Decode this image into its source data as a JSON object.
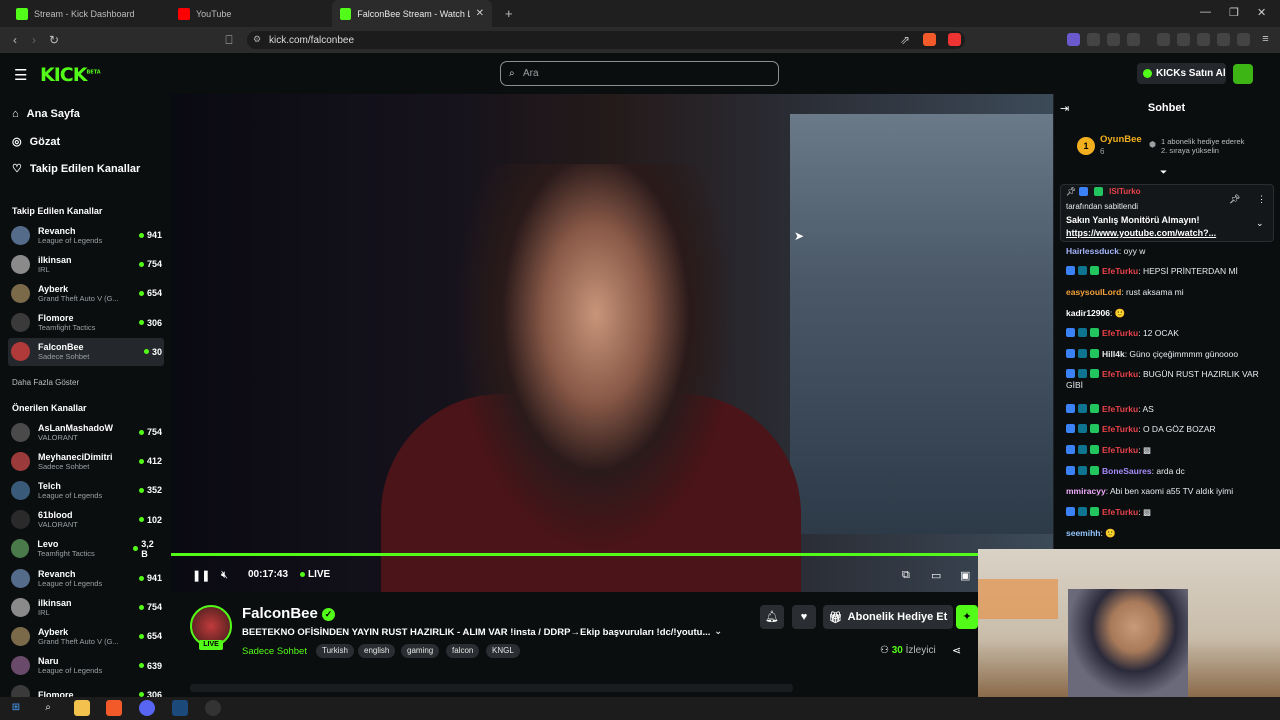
{
  "browser": {
    "tabs": [
      {
        "title": "Stream - Kick Dashboard",
        "color": "#53fc18"
      },
      {
        "title": "YouTube",
        "color": "#ff0000"
      },
      {
        "title": "FalconBee Stream - Watch Live o",
        "color": "#53fc18"
      }
    ],
    "url": "kick.com/falconbee"
  },
  "header": {
    "logo": "KICK",
    "logo_beta": "BETA",
    "search_placeholder": "Ara",
    "kicks_button": "KICKs Satın Al"
  },
  "sidebar": {
    "nav": [
      {
        "label": "Ana Sayfa",
        "icon": "home-icon"
      },
      {
        "label": "Gözat",
        "icon": "compass-icon"
      },
      {
        "label": "Takip Edilen Kanallar",
        "icon": "heart-icon"
      }
    ],
    "followed_title": "Takip Edilen Kanallar",
    "followed": [
      {
        "name": "Revanch",
        "category": "League of Legends",
        "viewers": "941",
        "color": "#556b8a"
      },
      {
        "name": "ilkinsan",
        "category": "IRL",
        "viewers": "754",
        "color": "#8a8a8a"
      },
      {
        "name": "Ayberk",
        "category": "Grand Theft Auto V (G...",
        "viewers": "654",
        "color": "#7a6a4a"
      },
      {
        "name": "Flomore",
        "category": "Teamfight Tactics",
        "viewers": "306",
        "color": "#3a3a3a"
      },
      {
        "name": "FalconBee",
        "category": "Sadece Sohbet",
        "viewers": "30",
        "color": "#b03a3a"
      }
    ],
    "show_more": "Daha Fazla Göster",
    "recommended_title": "Önerilen Kanallar",
    "recommended": [
      {
        "name": "AsLanMashadoW",
        "category": "VALORANT",
        "viewers": "754",
        "color": "#4a4a4a"
      },
      {
        "name": "MeyhaneciDimitri",
        "category": "Sadece Sohbet",
        "viewers": "412",
        "color": "#9a3a3a"
      },
      {
        "name": "Telch",
        "category": "League of Legends",
        "viewers": "352",
        "color": "#3a5a7a"
      },
      {
        "name": "61blood",
        "category": "VALORANT",
        "viewers": "102",
        "color": "#2a2a2a"
      },
      {
        "name": "Levo",
        "category": "Teamfight Tactics",
        "viewers": "3,2 B",
        "color": "#4a7a4a"
      },
      {
        "name": "Revanch",
        "category": "League of Legends",
        "viewers": "941",
        "color": "#556b8a"
      },
      {
        "name": "ilkinsan",
        "category": "IRL",
        "viewers": "754",
        "color": "#8a8a8a"
      },
      {
        "name": "Ayberk",
        "category": "Grand Theft Auto V (G...",
        "viewers": "654",
        "color": "#7a6a4a"
      },
      {
        "name": "Naru",
        "category": "League of Legends",
        "viewers": "639",
        "color": "#6a4a6a"
      },
      {
        "name": "Flomore",
        "category": "",
        "viewers": "306",
        "color": "#3a3a3a"
      }
    ]
  },
  "player": {
    "time": "00:17:43",
    "live_label": "LIVE",
    "progress": 0.915
  },
  "channel": {
    "name": "FalconBee",
    "live_badge": "LIVE",
    "title": "BEETEKNO OFİSİNDEN YAYIN RUST HAZIRLIK - ALIM VAR  !insta / DDRP→Ekip başvuruları !dc/!youtu...",
    "category": "Sadece Sohbet",
    "tags": [
      "Turkish",
      "english",
      "gaming",
      "falcon",
      "KNGL"
    ],
    "subscribe_button": "Abonelik Hediye Et",
    "viewers": "30",
    "viewers_label": "İzleyici"
  },
  "chat": {
    "title": "Sohbet",
    "gifter_rank": "1",
    "gifter_name": "OyunBee",
    "gifter_count": "6",
    "gift_note_1": "1 abonelik hediye ederek",
    "gift_note_2": "2. sıraya yükselin",
    "pinned": {
      "user": "ISITurko",
      "by": "tarafından sabitlendi",
      "text": "Sakın Yanlış Monitörü Almayın!",
      "link": "https://www.youtube.com/watch?..."
    },
    "messages": [
      {
        "user": "Hairlessduck",
        "color": "#a5b4fc",
        "text": "oyy w",
        "badges": false
      },
      {
        "user": "EfeTurku",
        "color": "#e8424a",
        "text": "HEPSİ PRİNTERDAN Mİ",
        "badges": true
      },
      {
        "user": "easysoulLord",
        "color": "#f2a23a",
        "text": "rust aksama mi",
        "badges": false
      },
      {
        "user": "kadir12906",
        "color": "#ffffff",
        "text": "🙂",
        "badges": false
      },
      {
        "user": "EfeTurku",
        "color": "#e8424a",
        "text": "12 OCAK",
        "badges": true
      },
      {
        "user": "Hill4k",
        "color": "#e9e9e9",
        "text": "Güno çiçeğimmmm günoooo",
        "badges": true
      },
      {
        "user": "EfeTurku",
        "color": "#e8424a",
        "text": "BUGÜN RUST HAZIRLIK VAR GİBİ",
        "badges": true
      },
      {
        "user": "EfeTurku",
        "color": "#e8424a",
        "text": "AS",
        "badges": true
      },
      {
        "user": "EfeTurku",
        "color": "#e8424a",
        "text": "O DA GÖZ BOZAR",
        "badges": true
      },
      {
        "user": "EfeTurku",
        "color": "#e8424a",
        "text": "▩",
        "badges": true
      },
      {
        "user": "BoneSaures",
        "color": "#a78bfa",
        "text": "arda dc",
        "badges": true
      },
      {
        "user": "mmiracyy",
        "color": "#f0abfc",
        "text": "Abi ben xaomi a55 TV aldık iyimi",
        "badges": false
      },
      {
        "user": "EfeTurku",
        "color": "#e8424a",
        "text": "▩",
        "badges": true
      },
      {
        "user": "seemihh",
        "color": "#93c5fd",
        "text": "🙂",
        "badges": false
      }
    ]
  },
  "colors": {
    "accent": "#53fc18",
    "bg": "#0b0e0f"
  }
}
